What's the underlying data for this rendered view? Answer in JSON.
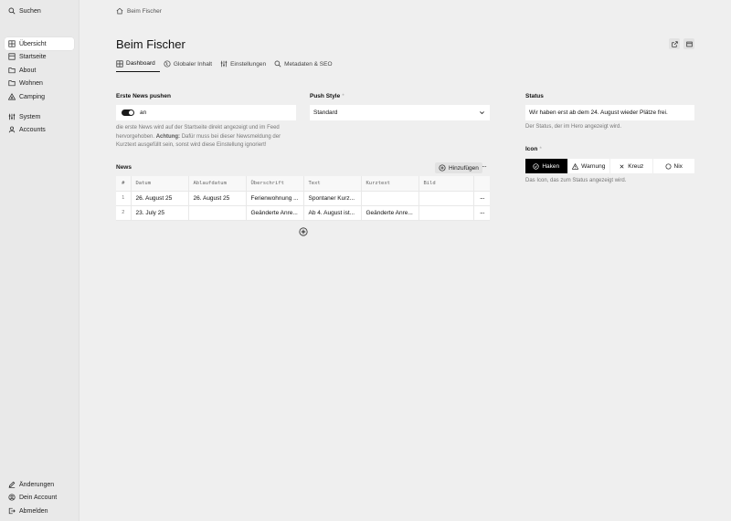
{
  "sidebar": {
    "search": "Suchen",
    "items": [
      {
        "label": "Übersicht"
      },
      {
        "label": "Startseite"
      },
      {
        "label": "About"
      },
      {
        "label": "Wohnen"
      },
      {
        "label": "Camping"
      },
      {
        "label": "System"
      },
      {
        "label": "Accounts"
      }
    ],
    "footer": [
      {
        "label": "Änderungen"
      },
      {
        "label": "Dein Account"
      },
      {
        "label": "Abmelden"
      }
    ]
  },
  "breadcrumb": "Beim Fischer",
  "page_title": "Beim Fischer",
  "tabs": [
    {
      "label": "Dashboard"
    },
    {
      "label": "Globaler Inhalt"
    },
    {
      "label": "Einstellungen"
    },
    {
      "label": "Metadaten & SEO"
    }
  ],
  "push": {
    "label": "Erste News pushen",
    "toggle_text": "an",
    "help_1": "die erste News wird auf der Startseite direkt angezeigt und im Feed hervorgehoben.",
    "help_bold": "Achtung:",
    "help_2": "Dafür muss bei dieser Newsmeldung der Kurztext ausgefüllt sein, sonst wird diese Einstellung ignoriert!"
  },
  "push_style": {
    "label": "Push Style",
    "required": "*",
    "value": "Standard"
  },
  "status": {
    "label": "Status",
    "value": "Wir haben erst ab dem 24. August wieder Plätze frei.",
    "help": "Der Status, der im Hero angezeigt wird."
  },
  "icon_field": {
    "label": "Icon",
    "required": "*",
    "options": [
      {
        "label": "Haken"
      },
      {
        "label": "Warnung"
      },
      {
        "label": "Kreuz"
      },
      {
        "label": "Nix"
      }
    ],
    "help": "Das Icon, das zum Status angezeigt wird."
  },
  "news": {
    "label": "News",
    "add_label": "Hinzufügen",
    "more": "···",
    "columns": [
      "#",
      "Datum",
      "Ablaufdatum",
      "Überschrift",
      "Text",
      "Kurztext",
      "Bild"
    ],
    "rows": [
      {
        "num": "1",
        "datum": "26. August 25",
        "ablauf": "26. August 25",
        "ueberschrift": "Ferienwohnung ...",
        "text": "Spontaner Kurz...",
        "kurztext": "",
        "bild": ""
      },
      {
        "num": "2",
        "datum": "23. July 25",
        "ablauf": "",
        "ueberschrift": "Geänderte Anre...",
        "text": "Ab 4. August ist...",
        "kurztext": "Geänderte Anre...",
        "bild": ""
      }
    ]
  }
}
